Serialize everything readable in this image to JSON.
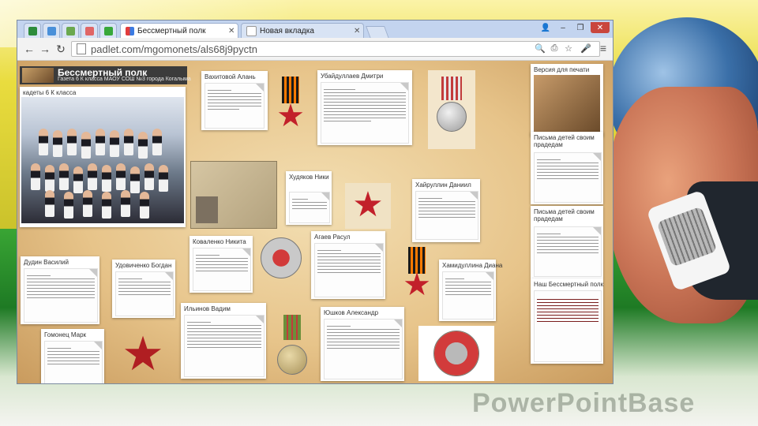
{
  "browser": {
    "tabs": [
      {
        "label": "",
        "icon": "padlet-icon"
      },
      {
        "label": "",
        "icon": "app-icon"
      },
      {
        "label": "",
        "icon": "app-icon"
      },
      {
        "label": "",
        "icon": "app-icon"
      },
      {
        "label": "",
        "icon": "padlet-icon"
      },
      {
        "label": "Бессмертный полк",
        "icon": "padlet-icon",
        "active": true
      },
      {
        "label": "Новая вкладка",
        "icon": "page-icon"
      }
    ],
    "url": "padlet.com/mgomonets/als68j9pyctn"
  },
  "board": {
    "title": "Бессмертный полк",
    "subtitle": "Газета 6 К класса МАОУ СОШ №3 города Когалыма",
    "posts": {
      "class_photo": "кадеты 6 К класса",
      "vakhitov": "Вахитовой Алань",
      "ubaydullaev": "Убайдуллаев Дмитри",
      "khudyakov": "Худяков Ники",
      "khalyullin": "Хайруллин Даниил",
      "kovalenko": "Коваленко Никита",
      "agaev": "Агаев Расул",
      "khamidullina": "Хамидуллина Диана",
      "dudin": "Дудин Василий",
      "udovichenko": "Удовиченко Богдан",
      "ilyinov": "Ильинов Вадим",
      "yushkov": "Юшков Александр",
      "gomonets": "Гомонец Марк",
      "version_print": "Версия для печати",
      "letters_1": "Письма детей своим прадедам",
      "letters_2": "Письма детей своим прадедам",
      "our_regiment": "Наш Бессмертный полк"
    }
  },
  "slide": {
    "brand": "PowerPointBase"
  },
  "colors": {
    "board_bg": "#e7c48a",
    "header_bg": "#3b3b3b",
    "tab_bar": "#c3d4ef"
  }
}
